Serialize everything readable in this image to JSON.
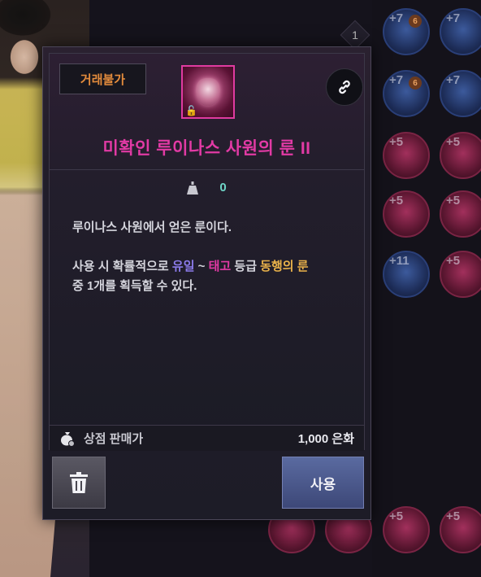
{
  "background": {
    "slot_badges": [
      "+7",
      "+7",
      "+7",
      "+7",
      "+5",
      "+5",
      "+5",
      "+5",
      "+11",
      "+5",
      "+5",
      "+5"
    ],
    "slot_tags": [
      "6",
      "6"
    ],
    "number_marker": "1"
  },
  "tooltip": {
    "trade_badge": "거래불가",
    "item_title": "미확인 루이나스 사원의 룬 II",
    "weight_value": "0",
    "description": {
      "line1": "루이나스 사원에서 얻은 룬이다.",
      "line2_prefix": "사용 시 확률적으로 ",
      "grade_unique": "유일",
      "tilde": " ~ ",
      "grade_ancient": "태고",
      "grade_suffix": " 등급 ",
      "companion_rune": "동행의 룬",
      "line3": "중 1개를 획득할 수 있다."
    },
    "price_label": "상점 판매가",
    "price_value": "1,000 은화"
  },
  "actions": {
    "use_label": "사용"
  },
  "colors": {
    "title_rarity": "#e23aa5",
    "trade_badge": "#e38b3c",
    "unique": "#8b7bea",
    "ancient": "#e23aa5",
    "companion": "#e8b14a",
    "weight_value": "#6fd6c8"
  },
  "icons": {
    "link": "link-icon",
    "weight": "weight-icon",
    "price": "money-bag-icon",
    "delete": "trash-icon",
    "lock": "lock-icon"
  }
}
